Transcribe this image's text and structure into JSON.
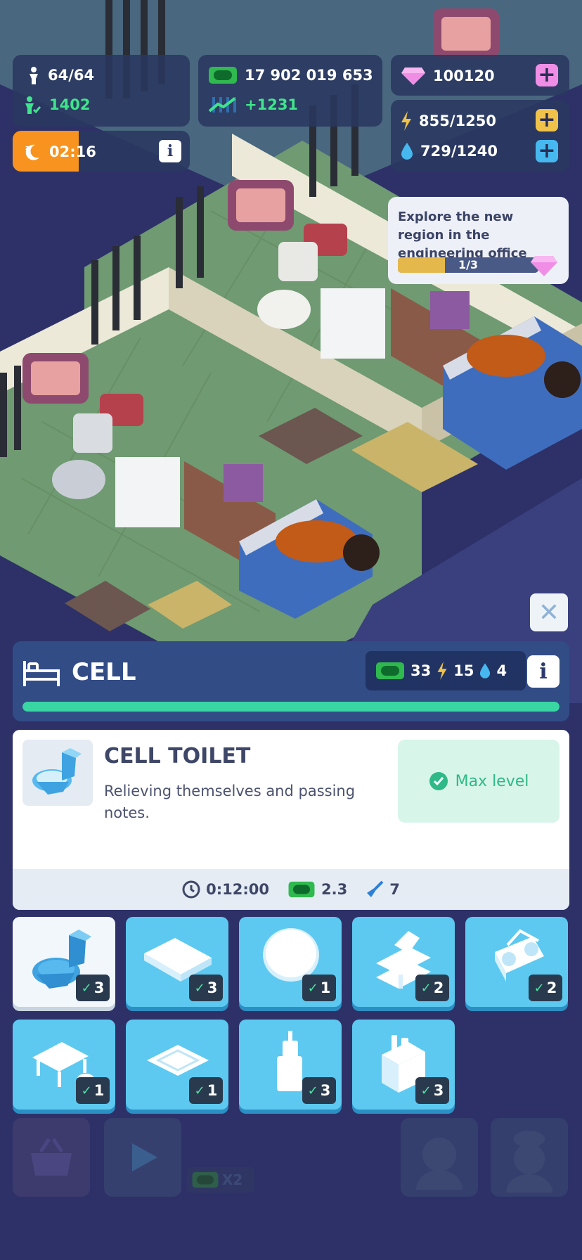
{
  "hud": {
    "population": "64/64",
    "prisoner_count": "1402",
    "sleep_timer": "02:16",
    "money": "17 902 019 653",
    "income": "+1231",
    "gems": "100120",
    "energy": "855/1250",
    "water": "729/1240",
    "info_label": "i",
    "plus_label": "+"
  },
  "quest": {
    "text": "Explore the new region in the engineering office",
    "progress_label": "1/3",
    "progress_value": 0.333
  },
  "close_label": "✕",
  "cell_panel": {
    "title": "CELL",
    "cost_money": "33",
    "cost_energy": "15",
    "cost_water": "4",
    "info_label": "i",
    "progress_value": 1.0
  },
  "item_detail": {
    "name": "CELL TOILET",
    "description": "Relieving themselves and passing notes.",
    "status": "Max level",
    "time": "0:12:00",
    "money_rate": "2.3",
    "cleaning": "7"
  },
  "items": [
    {
      "name": "toilet",
      "level": "3",
      "selected": true
    },
    {
      "name": "bed",
      "level": "3"
    },
    {
      "name": "mirror",
      "level": "1"
    },
    {
      "name": "shelf",
      "level": "2"
    },
    {
      "name": "radio",
      "level": "2"
    },
    {
      "name": "table",
      "level": "1"
    },
    {
      "name": "rug",
      "level": "1"
    },
    {
      "name": "sink",
      "level": "3"
    },
    {
      "name": "cabinet",
      "level": "3"
    }
  ],
  "bottom_bar": {
    "multiplier": "X2"
  },
  "colors": {
    "hud_bg": "#293860",
    "money_green": "#3fe58b",
    "gem_pink": "#f08ee6",
    "energy_yellow": "#f0c24a",
    "water_blue": "#46b8ef",
    "sleep_orange": "#f7931e",
    "tile_blue": "#5dc9f0",
    "max_level_green": "#2fb988"
  }
}
